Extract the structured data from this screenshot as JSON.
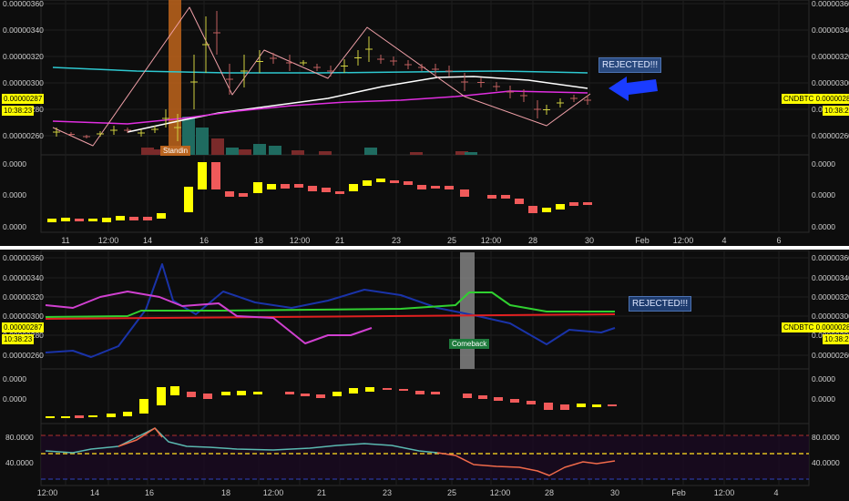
{
  "symbol": "CNDBTC",
  "price_tag": "0.00000287",
  "time_tag": "10:38:23",
  "colors": {
    "up": "#ffff00",
    "down": "#f05a5a",
    "vol_up": "#1f6b60",
    "vol_down": "#7a2a2a",
    "ma_cyan": "#2ec8d0",
    "ma_white": "#ffffff",
    "ma_magenta": "#e02ee0",
    "zigzag": "#f0a0a8",
    "line_blue": "#1a33a8",
    "line_green": "#30d030",
    "line_red": "#e02020",
    "line_magenta": "#d040d0",
    "rsi": "#5ab8b0",
    "rsi_hot": "#f06a4a",
    "arrow": "#1a3cff"
  },
  "top_panel": {
    "y_labels": [
      "0.00000360",
      "0.00000340",
      "0.00000320",
      "0.00000300",
      "0.00000280",
      "0.00000260"
    ],
    "right_labels": [
      "0.00000360",
      "0.00000340",
      "0.00000320",
      "0.00000300",
      "0.00000280",
      "0.00000260"
    ],
    "annotation": "REJECTED!!!",
    "signal_label": "Standin",
    "arrow_icon": "left-arrow"
  },
  "osc1_panel": {
    "y_labels": [
      "0.0000",
      "0.0000",
      "0.0000"
    ]
  },
  "bottom_time_axis_top": [
    "11",
    "12:00",
    "14",
    "16",
    "18",
    "12:00",
    "21",
    "23",
    "25",
    "12:00",
    "28",
    "30",
    "Feb",
    "12:00",
    "4",
    "6"
  ],
  "lower_panel": {
    "y_labels": [
      "0.00000360",
      "0.00000340",
      "0.00000320",
      "0.00000300",
      "0.00000280",
      "0.00000260"
    ],
    "right_labels": [
      "0.00000360",
      "0.00000340",
      "0.00000320",
      "0.00000300",
      "0.00000280",
      "0.00000260"
    ],
    "annotation": "REJECTED!!!",
    "signal_label": "Comeback"
  },
  "osc2_panel": {
    "y_labels": [
      "0.0000",
      "0.0000"
    ]
  },
  "rsi_panel": {
    "y_labels": [
      "80.0000",
      "40.0000"
    ],
    "right_labels": [
      "80.0000",
      "40.0000"
    ]
  },
  "bottom_time_axis": [
    "12:00",
    "14",
    "16",
    "18",
    "12:00",
    "21",
    "23",
    "25",
    "12:00",
    "28",
    "30",
    "Feb",
    "12:00",
    "4"
  ]
}
